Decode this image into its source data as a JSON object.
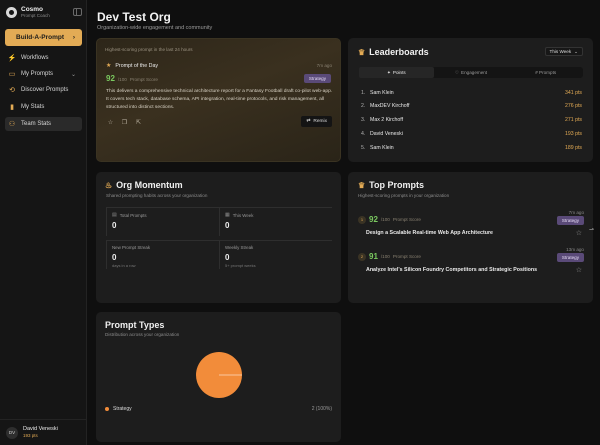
{
  "brand": {
    "name": "Cosmo",
    "sub": "Prompt Coach"
  },
  "sidebar": {
    "build_label": "Build-A-Prompt",
    "build_chevron": "›",
    "items": [
      {
        "label": "Workflows",
        "icon": "workflow-icon",
        "glyph": "⚡"
      },
      {
        "label": "My Prompts",
        "icon": "folder-icon",
        "glyph": "▭",
        "chevron": "⌄"
      },
      {
        "label": "Discover Prompts",
        "icon": "compass-icon",
        "glyph": "⟲"
      },
      {
        "label": "My Stats",
        "icon": "chart-icon",
        "glyph": "▮"
      },
      {
        "label": "Team Stats",
        "icon": "users-icon",
        "glyph": "⚇",
        "active": true
      }
    ]
  },
  "user": {
    "initials": "DV",
    "name": "David Veneski",
    "points": "193 pts"
  },
  "page": {
    "title": "Dev Test Org",
    "subtitle": "Organization-wide engagement and community"
  },
  "potd": {
    "header": "Highest-scoring prompt in the last 24 hours",
    "label": "Prompt of the Day",
    "age": "7m ago",
    "score": "92",
    "max": "/100",
    "score_label": "Prompt Score",
    "tag": "Strategy",
    "description": "This delivers a comprehensive technical architecture report for a Fantasy Football draft co-pilot web-app. It covers tech stack, database schema, API integration, real-time protocols, and risk management, all structured into distinct sections.",
    "remix": "Remix"
  },
  "leaderboard": {
    "title": "Leaderboards",
    "period": "This Week",
    "tabs": [
      "Points",
      "Engagement",
      "# Prompts"
    ],
    "rows": [
      {
        "rank": "1.",
        "name": "Sam Klein",
        "pts": "341 pts"
      },
      {
        "rank": "2.",
        "name": "MaxDEV Kirchoff",
        "pts": "276 pts"
      },
      {
        "rank": "3.",
        "name": "Max 2 Kirchoff",
        "pts": "271 pts"
      },
      {
        "rank": "4.",
        "name": "David Veneski",
        "pts": "193 pts"
      },
      {
        "rank": "5.",
        "name": "Sam Klein",
        "pts": "189 pts"
      }
    ]
  },
  "momentum": {
    "title": "Org Momentum",
    "subtitle": "Shared prompting habits across your organization",
    "stats": [
      {
        "label": "Total Prompts",
        "value": "0",
        "sub": ""
      },
      {
        "label": "This Week",
        "value": "0",
        "sub": ""
      },
      {
        "label": "New Prompt Streak",
        "value": "0",
        "sub": "days in a row"
      },
      {
        "label": "Weekly Streak",
        "value": "0",
        "sub": "5+ prompt weeks"
      }
    ]
  },
  "top_prompts": {
    "title": "Top Prompts",
    "subtitle": "Highest-scoring prompts in your organization",
    "items": [
      {
        "rank": "1",
        "score": "92",
        "max": "/100",
        "score_label": "Prompt Score",
        "age": "7m ago",
        "tag": "Strategy",
        "title": "Design a Scalable Real-time Web App Architecture"
      },
      {
        "rank": "2",
        "score": "91",
        "max": "/100",
        "score_label": "Prompt Score",
        "age": "13m ago",
        "tag": "Strategy",
        "title": "Analyze Intel's Silicon Foundry Competitors and Strategic Positions"
      }
    ]
  },
  "prompt_types": {
    "title": "Prompt Types",
    "subtitle": "Distribution across your organization",
    "legend": [
      {
        "label": "Strategy",
        "value": "2 (100%)",
        "color": "#f28c3a"
      }
    ]
  },
  "chart_data": {
    "type": "pie",
    "categories": [
      "Strategy"
    ],
    "values": [
      2
    ]
  },
  "colors": {
    "accent": "#e3ab55",
    "score_green": "#7ac95f",
    "tag_purple": "#5a4a78",
    "pie": "#f28c3a"
  }
}
